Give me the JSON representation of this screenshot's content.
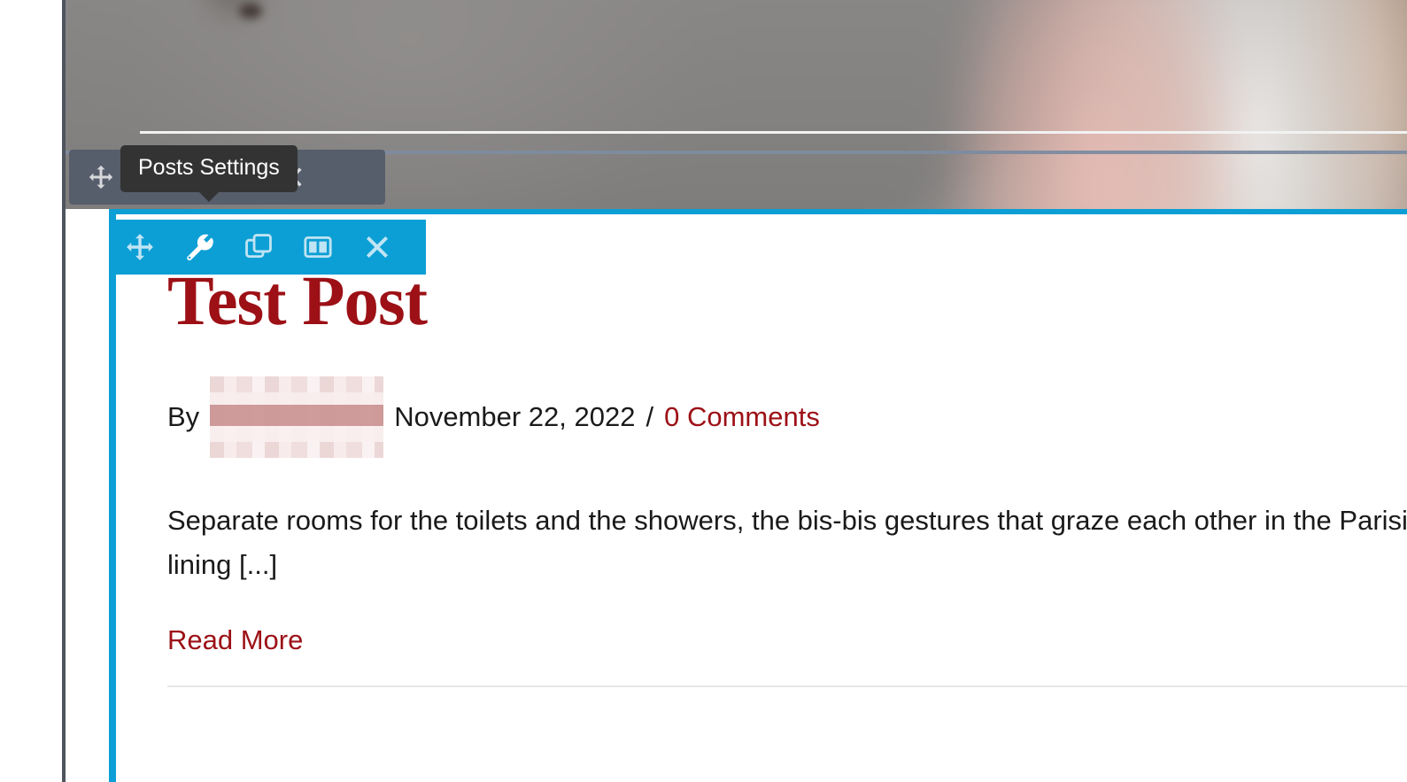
{
  "window": {
    "background_color": "#ffffff",
    "frame_rule_color": "#4f545e"
  },
  "hero": {
    "description": "blurred featured image background",
    "background_color": "#848282"
  },
  "tooltip": {
    "label": "Posts Settings",
    "background_color": "#333333",
    "text_color": "#ffffff"
  },
  "module_toolbar_outer": {
    "background_color": "#565d6b",
    "buttons": [
      {
        "icon": "move-icon",
        "label": "Move"
      },
      {
        "icon": "settings-gear-icon",
        "label": "Settings"
      },
      {
        "icon": "duplicate-icon",
        "label": "Duplicate"
      },
      {
        "icon": "close-icon",
        "label": "Close"
      }
    ]
  },
  "module_toolbar_inner": {
    "background_color": "#0c9fd5",
    "active_index": 1,
    "buttons": [
      {
        "icon": "move-icon",
        "label": "Move"
      },
      {
        "icon": "wrench-icon",
        "label": "Posts Settings"
      },
      {
        "icon": "duplicate-icon",
        "label": "Duplicate"
      },
      {
        "icon": "columns-layout-icon",
        "label": "Column Layout"
      },
      {
        "icon": "close-icon",
        "label": "Close"
      }
    ]
  },
  "post": {
    "title": "Test Post",
    "title_color": "#9c1016",
    "meta": {
      "by_label": "By",
      "author": "",
      "author_redacted": true,
      "date": "November 22, 2022",
      "separator": "/",
      "comments": "0 Comments",
      "comments_color": "#9c1016"
    },
    "excerpt": "Separate rooms for the toilets and the showers, the bis-bis gestures that graze each other in the Parisians lining [...]",
    "read_more": "Read More",
    "read_more_color": "#9c1016"
  },
  "accent_color": "#0c9fd5"
}
